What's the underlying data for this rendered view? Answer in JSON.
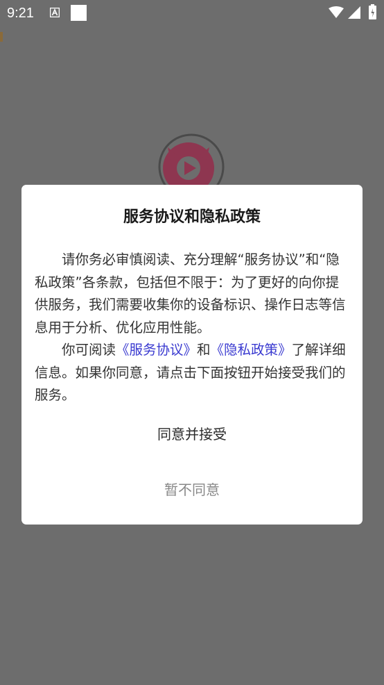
{
  "status_bar": {
    "time": "9:21",
    "icons": [
      "a-notification-icon",
      "square-notification-icon",
      "wifi-icon",
      "signal-icon",
      "battery-icon"
    ]
  },
  "app_logo": {
    "icon": "video-play-cat-icon",
    "color": "#c0476a"
  },
  "dialog": {
    "title": "服务协议和隐私政策",
    "paragraph1": "请你务必审慎阅读、充分理解“服务协议”和“隐私政策”各条款，包括但不限于：为了更好的向你提供服务，我们需要收集你的设备标识、操作日志等信息用于分析、优化应用性能。",
    "paragraph2": {
      "prefix": "你可阅读",
      "service_link": "《服务协议》",
      "middle": "和",
      "privacy_link": "《隐私政策》",
      "suffix": "了解详细信息。如果你同意，请点击下面按钮开始接受我们的服务。"
    },
    "agree_label": "同意并接受",
    "disagree_label": "暂不同意",
    "link_color": "#3a3ad0"
  },
  "colors": {
    "overlay": "#6d6d6d",
    "dialog_background": "#ffffff"
  }
}
